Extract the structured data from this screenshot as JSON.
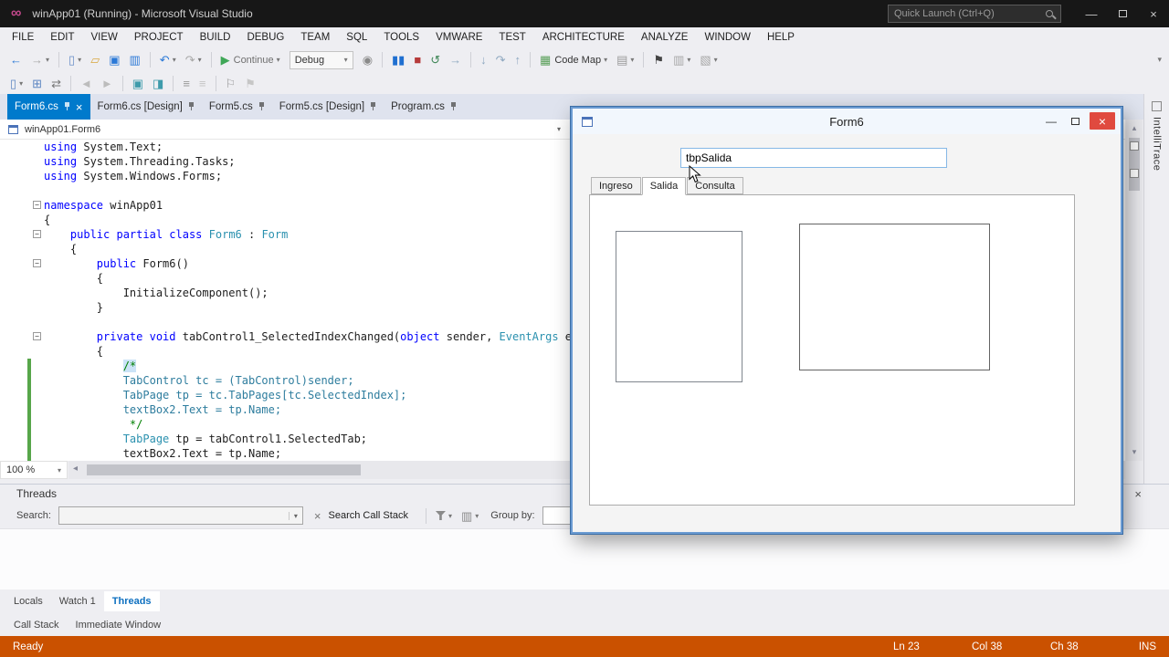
{
  "titlebar": {
    "title": "winApp01 (Running) - Microsoft Visual Studio",
    "quick_launch": "Quick Launch (Ctrl+Q)"
  },
  "menus": [
    "FILE",
    "EDIT",
    "VIEW",
    "PROJECT",
    "BUILD",
    "DEBUG",
    "TEAM",
    "SQL",
    "TOOLS",
    "VMWARE",
    "TEST",
    "ARCHITECTURE",
    "ANALYZE",
    "WINDOW",
    "HELP"
  ],
  "toolbar": {
    "items": [
      {
        "name": "nav-back-icon",
        "glyph": "←",
        "color": "#2b79d7"
      },
      {
        "name": "nav-forward-icon",
        "glyph": "→",
        "color": "#a8a8a8",
        "caret": true
      },
      {
        "sep": true
      },
      {
        "name": "new-file-icon",
        "glyph": "▯",
        "color": "#6a8fc8",
        "caret": true
      },
      {
        "name": "open-file-icon",
        "glyph": "▱",
        "color": "#d9a741"
      },
      {
        "name": "save-icon",
        "glyph": "▣",
        "color": "#2b79d7"
      },
      {
        "name": "save-all-icon",
        "glyph": "▥",
        "color": "#2b79d7"
      },
      {
        "sep": true
      },
      {
        "name": "undo-icon",
        "glyph": "↶",
        "color": "#2b79d7",
        "caret": true
      },
      {
        "name": "redo-icon",
        "glyph": "↷",
        "color": "#a8a8a8",
        "caret": true
      },
      {
        "sep": true
      },
      {
        "name": "continue-button",
        "glyph": "▶",
        "color": "#3fa757",
        "label": "Continue",
        "labelcolor": "#6f6f6f",
        "caret": true
      },
      {
        "name": "debug-target-combo",
        "combo": "Debug"
      },
      {
        "name": "attach-process-icon",
        "glyph": "◉",
        "color": "#8a8a8a"
      },
      {
        "sep": true
      },
      {
        "name": "break-all-icon",
        "glyph": "▮▮",
        "color": "#1f6fd0"
      },
      {
        "name": "stop-debugging-icon",
        "glyph": "■",
        "color": "#b63a3a"
      },
      {
        "name": "restart-icon",
        "glyph": "↺",
        "color": "#3f8757"
      },
      {
        "name": "show-next-statement-icon",
        "glyph": "→",
        "color": "#8fa8c0"
      },
      {
        "sep": true
      },
      {
        "name": "step-into-icon",
        "glyph": "↓",
        "color": "#8fa8c0"
      },
      {
        "name": "step-over-icon",
        "glyph": "↷",
        "color": "#8fa8c0"
      },
      {
        "name": "step-out-icon",
        "glyph": "↑",
        "color": "#8fa8c0"
      },
      {
        "sep": true
      },
      {
        "name": "code-map-icon",
        "glyph": "▦",
        "color": "#5aa05a",
        "label": "Code Map",
        "labelcolor": "#333333",
        "caret": true
      },
      {
        "name": "diagnostics-icon",
        "glyph": "▤",
        "color": "#9a9a9a",
        "caret": true
      },
      {
        "sep": true
      },
      {
        "name": "breakpoint-flag-icon",
        "glyph": "⚑",
        "color": "#444444"
      },
      {
        "name": "intellitrace-events-icon",
        "glyph": "▥",
        "color": "#a8a8a8",
        "caret": true
      },
      {
        "name": "watch-window-icon",
        "glyph": "▧",
        "color": "#a8a8a8",
        "caret": true
      }
    ]
  },
  "toolbar2": {
    "items": [
      {
        "name": "new-item-icon",
        "glyph": "▯",
        "color": "#5e87c2",
        "caret": true
      },
      {
        "name": "add-form-icon",
        "glyph": "⊞",
        "color": "#5e87c2"
      },
      {
        "name": "swap-view-icon",
        "glyph": "⇄",
        "color": "#777777"
      },
      {
        "sep": true
      },
      {
        "name": "navigate-back-icon",
        "glyph": "◄",
        "color": "#bcbcbc"
      },
      {
        "name": "navigate-forward-icon",
        "glyph": "►",
        "color": "#bcbcbc"
      },
      {
        "sep": true
      },
      {
        "name": "display-method-icon",
        "glyph": "▣",
        "color": "#3e9bab"
      },
      {
        "name": "display-field-icon",
        "glyph": "◨",
        "color": "#3e9bab"
      },
      {
        "sep": true
      },
      {
        "name": "comment-icon",
        "glyph": "≡",
        "color": "#9a9a9a"
      },
      {
        "name": "uncomment-icon",
        "glyph": "≡",
        "color": "#c6c6c6"
      },
      {
        "sep": true
      },
      {
        "name": "bookmark-icon",
        "glyph": "⚐",
        "color": "#9a9a9a"
      },
      {
        "name": "next-bookmark-icon",
        "glyph": "⚑",
        "color": "#c6c6c6"
      }
    ]
  },
  "doc_tabs": [
    {
      "label": "Form6.cs",
      "active": true
    },
    {
      "label": "Form6.cs [Design]",
      "active": false
    },
    {
      "label": "Form5.cs",
      "active": false
    },
    {
      "label": "Form5.cs [Design]",
      "active": false
    },
    {
      "label": "Program.cs",
      "active": false
    }
  ],
  "editor": {
    "breadcrumb": "winApp01.Form6",
    "zoom": "100 %",
    "code": [
      {
        "s": [
          [
            "using",
            "kw"
          ],
          [
            " System.Text;",
            "pl"
          ]
        ]
      },
      {
        "s": [
          [
            "using",
            "kw"
          ],
          [
            " System.Threading.Tasks;",
            "pl"
          ]
        ]
      },
      {
        "s": [
          [
            "using",
            "kw"
          ],
          [
            " System.Windows.Forms;",
            "pl"
          ]
        ]
      },
      {
        "s": [
          [
            "",
            "pl"
          ]
        ]
      },
      {
        "fold": true,
        "s": [
          [
            "namespace",
            "kw"
          ],
          [
            " winApp01",
            "pl"
          ]
        ]
      },
      {
        "s": [
          [
            "{",
            "pl"
          ]
        ]
      },
      {
        "fold": true,
        "s": [
          [
            "    ",
            "pl"
          ],
          [
            "public partial class",
            "kw"
          ],
          [
            " ",
            "pl"
          ],
          [
            "Form6",
            "ty"
          ],
          [
            " : ",
            "pl"
          ],
          [
            "Form",
            "ty"
          ]
        ]
      },
      {
        "s": [
          [
            "    {",
            "pl"
          ]
        ]
      },
      {
        "fold": true,
        "s": [
          [
            "        ",
            "pl"
          ],
          [
            "public",
            "kw"
          ],
          [
            " Form6()",
            "pl"
          ]
        ]
      },
      {
        "s": [
          [
            "        {",
            "pl"
          ]
        ]
      },
      {
        "s": [
          [
            "            InitializeComponent();",
            "pl"
          ]
        ]
      },
      {
        "s": [
          [
            "        }",
            "pl"
          ]
        ]
      },
      {
        "s": [
          [
            "",
            "pl"
          ]
        ]
      },
      {
        "fold": true,
        "s": [
          [
            "        ",
            "pl"
          ],
          [
            "private void",
            "kw"
          ],
          [
            " tabControl1_SelectedIndexChanged(",
            "pl"
          ],
          [
            "object",
            "kw"
          ],
          [
            " sender, ",
            "pl"
          ],
          [
            "EventArgs",
            "ty"
          ],
          [
            " e)",
            "pl"
          ]
        ]
      },
      {
        "s": [
          [
            "        {",
            "pl"
          ]
        ]
      },
      {
        "chg": true,
        "s": [
          [
            "            ",
            "pl"
          ],
          [
            "/*",
            "cm",
            "hl"
          ]
        ]
      },
      {
        "chg": true,
        "s": [
          [
            "            ",
            "pl"
          ],
          [
            "TabControl tc = (TabControl)sender;",
            "cc"
          ]
        ]
      },
      {
        "chg": true,
        "s": [
          [
            "            ",
            "pl"
          ],
          [
            "TabPage tp = tc.TabPages[tc.SelectedIndex];",
            "cc"
          ]
        ]
      },
      {
        "chg": true,
        "s": [
          [
            "            ",
            "pl"
          ],
          [
            "textBox2.Text = tp.Name;",
            "cc"
          ]
        ]
      },
      {
        "chg": true,
        "s": [
          [
            "             */",
            "cm"
          ]
        ]
      },
      {
        "chg": true,
        "s": [
          [
            "            ",
            "pl"
          ],
          [
            "TabPage",
            "ty"
          ],
          [
            " tp = tabControl1.SelectedTab;",
            "pl"
          ]
        ]
      },
      {
        "chg": true,
        "s": [
          [
            "            ",
            "pl"
          ],
          [
            "textBox2.Text = tp.Name;",
            "pl"
          ]
        ]
      }
    ]
  },
  "threads_panel": {
    "title": "Threads",
    "search_label": "Search:",
    "search_call_stack": "Search Call Stack",
    "group_by": "Group by:"
  },
  "tool_tabs_row1": [
    {
      "label": "Locals",
      "active": false
    },
    {
      "label": "Watch 1",
      "active": false
    },
    {
      "label": "Threads",
      "active": true
    }
  ],
  "tool_tabs_row2": [
    {
      "label": "Call Stack",
      "active": false
    },
    {
      "label": "Immediate Window",
      "active": false
    }
  ],
  "statusbar": {
    "ready": "Ready",
    "ln": "Ln 23",
    "col": "Col 38",
    "ch": "Ch 38",
    "ins": "INS"
  },
  "form_window": {
    "title": "Form6",
    "textbox_value": "tbpSalida",
    "tabs": [
      {
        "label": "Ingreso",
        "selected": false
      },
      {
        "label": "Salida",
        "selected": true
      },
      {
        "label": "Consulta",
        "selected": false
      }
    ]
  },
  "right_rail": {
    "intellitrace": "IntelliTrace"
  },
  "colors": {
    "accent_tab": "#007acc",
    "status_debug": "#ca5100",
    "keyword": "#0000ff",
    "type": "#2b91af",
    "comment": "#008000",
    "commented_code": "#2e7d9e",
    "plain": "#1e1e1e",
    "change_bar": "#57a64a"
  }
}
